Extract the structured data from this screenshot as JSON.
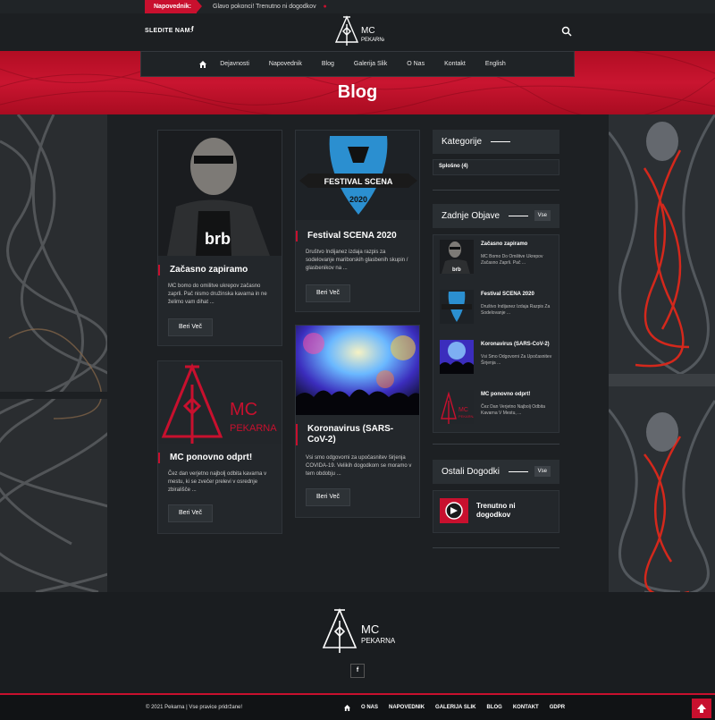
{
  "topbar": {
    "label": "Napovednik:",
    "ticker": "Glavo pokonci! Trenutno ni dogodkov"
  },
  "header": {
    "follow_label": "SLEDITE NAM:",
    "fb_icon": "f",
    "logo_text": [
      "MC",
      "PEKARNA"
    ]
  },
  "nav": {
    "items": [
      "Dejavnosti",
      "Napovednik",
      "Blog",
      "Galerija Slik",
      "O Nas",
      "Kontakt",
      "English"
    ]
  },
  "page": {
    "title": "Blog"
  },
  "posts": [
    {
      "title": "Začasno zapiramo",
      "excerpt": "MC bomo do omilitve ukrepov začasno zaprli. Pač nismo družinska kavarna in ne želimo vam dihat ...",
      "button": "Beri Več",
      "image_text": "brb"
    },
    {
      "title": "Festival SCENA 2020",
      "excerpt": "Društvo Indijanez izdaja razpis za sodelovanje mariborskih glasbenih skupin / glasbenikov na ...",
      "button": "Beri Več",
      "image_text": [
        "FESTIVAL SCENA",
        "2020"
      ]
    },
    {
      "title": "MC ponovno odprt!",
      "excerpt": "Čez dan verjetno najbolj odbita kavarna v mestu, ki se zvečer prelevi v osrednje zbirališče ...",
      "button": "Beri Več",
      "image_text": [
        "MC",
        "PEKARNA"
      ]
    },
    {
      "title": "Koronavirus (SARS-CoV-2)",
      "excerpt": "Vsi smo odgovorni za upočasnitev širjenja COVIDA-19. Velikih dogodkom se moramo v tem obdobju ...",
      "button": "Beri Več"
    }
  ],
  "sidebar": {
    "categories_title": "Kategorije",
    "categories": [
      "Splošno (4)"
    ],
    "recent_title": "Zadnje Objave",
    "recent_more": "Vse",
    "recent": [
      {
        "title": "Začasno zapiramo",
        "excerpt": "MC Bomo Do Omilitve Ukrepov Začasno Zaprli. Pač ..."
      },
      {
        "title": "Festival SCENA 2020",
        "excerpt": "Društvo Indijanez Izdaja Razpis Za Sodelovanje ..."
      },
      {
        "title": "Koronavirus (SARS-CoV-2)",
        "excerpt": "Vsi Smo Odgovorni Za Upočasnitev Širjenja ..."
      },
      {
        "title": "MC ponovno odprt!",
        "excerpt": "Čez Dan Verjetno Najbolj Odbita Kavarna V Mestu, ..."
      }
    ],
    "events_title": "Ostali Dogodki",
    "events_more": "Vse",
    "event": "Trenutno ni dogodkov"
  },
  "footer": {
    "fb_icon": "f",
    "copyright": "© 2021 Pekarna | Vse pravice pridržane!",
    "nav": [
      "O NAS",
      "NAPOVEDNIK",
      "GALERIJA SLIK",
      "BLOG",
      "KONTAKT",
      "GDPR"
    ]
  },
  "colors": {
    "accent": "#c8102e",
    "dark": "#1d2023",
    "card": "#23272b"
  }
}
